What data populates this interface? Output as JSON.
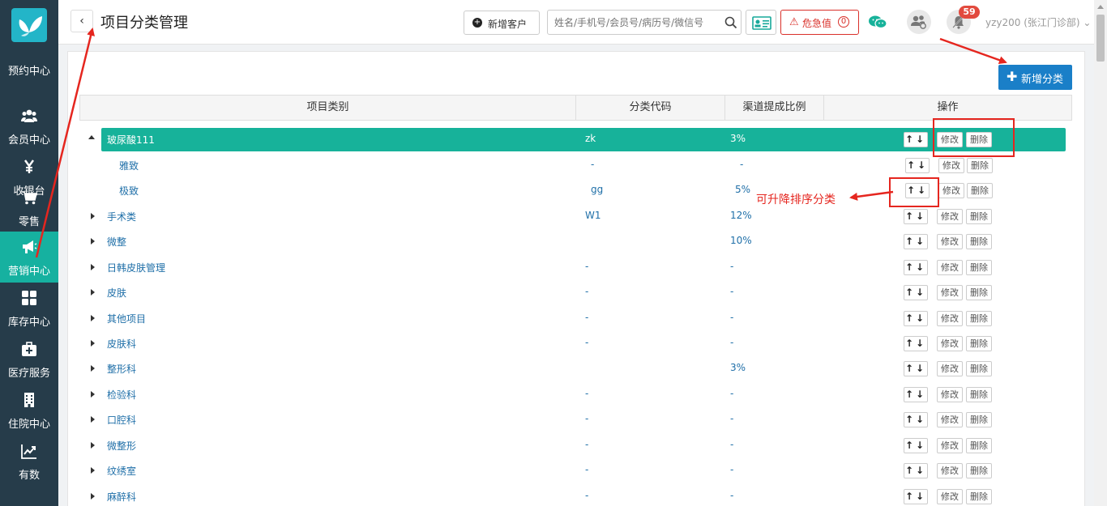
{
  "sidebar": {
    "items": [
      {
        "label": "预约中心",
        "icon": "calendar-icon"
      },
      {
        "label": "会员中心",
        "icon": "users-icon"
      },
      {
        "label": "收银台",
        "icon": "yen-icon"
      },
      {
        "label": "零售",
        "icon": "cart-icon"
      },
      {
        "label": "营销中心",
        "icon": "megaphone-icon",
        "active": true
      },
      {
        "label": "库存中心",
        "icon": "grid-icon"
      },
      {
        "label": "医疗服务",
        "icon": "medkit-icon"
      },
      {
        "label": "住院中心",
        "icon": "building-icon"
      },
      {
        "label": "有数",
        "icon": "trend-icon"
      }
    ]
  },
  "header": {
    "back": "‹",
    "title": "项目分类管理",
    "add_customer": "新增客户",
    "search_placeholder": "姓名/手机号/会员号/病历号/微信号",
    "critical_icon": "⚠",
    "critical_label": "危急值",
    "critical_count": "0",
    "notification_count": "59",
    "user": "yzy200 (张江门诊部) ⌄"
  },
  "toolbar": {
    "add_category": "新增分类",
    "add_category_plus": "✚"
  },
  "table": {
    "headers": [
      "项目类别",
      "分类代码",
      "渠道提成比例",
      "操作"
    ],
    "sort_label": "↑↓",
    "edit_label": "修改",
    "delete_label": "删除",
    "rows": [
      {
        "name": "玻尿酸111",
        "code": "zk",
        "ratio": "3%",
        "level": 0,
        "toggle": "expanded",
        "selected": true
      },
      {
        "name": "雅致",
        "code": "-",
        "ratio": "-",
        "level": 1,
        "toggle": "none"
      },
      {
        "name": "极致",
        "code": "gg",
        "ratio": "5%",
        "level": 1,
        "toggle": "none"
      },
      {
        "name": "手术类",
        "code": "W1",
        "ratio": "12%",
        "level": 0,
        "toggle": "collapsed"
      },
      {
        "name": "微整",
        "code": "",
        "ratio": "10%",
        "level": 0,
        "toggle": "collapsed"
      },
      {
        "name": "日韩皮肤管理",
        "code": "-",
        "ratio": "-",
        "level": 0,
        "toggle": "collapsed"
      },
      {
        "name": "皮肤",
        "code": "-",
        "ratio": "-",
        "level": 0,
        "toggle": "collapsed"
      },
      {
        "name": "其他项目",
        "code": "-",
        "ratio": "-",
        "level": 0,
        "toggle": "collapsed"
      },
      {
        "name": "皮肤科",
        "code": "-",
        "ratio": "-",
        "level": 0,
        "toggle": "collapsed"
      },
      {
        "name": "整形科",
        "code": "",
        "ratio": "3%",
        "level": 0,
        "toggle": "collapsed"
      },
      {
        "name": "检验科",
        "code": "-",
        "ratio": "-",
        "level": 0,
        "toggle": "collapsed"
      },
      {
        "name": "口腔科",
        "code": "-",
        "ratio": "-",
        "level": 0,
        "toggle": "collapsed"
      },
      {
        "name": "微整形",
        "code": "-",
        "ratio": "-",
        "level": 0,
        "toggle": "collapsed"
      },
      {
        "name": "纹绣室",
        "code": "-",
        "ratio": "-",
        "level": 0,
        "toggle": "collapsed"
      },
      {
        "name": "麻醉科",
        "code": "-",
        "ratio": "-",
        "level": 0,
        "toggle": "collapsed"
      }
    ]
  },
  "annotations": {
    "sort_note": "可升降排序分类"
  },
  "colors": {
    "sidebar_bg": "#263c4a",
    "active": "#16b1a0",
    "selected_row": "#17b29a",
    "primary_button": "#1a7fc8",
    "annotation": "#e5261f",
    "link_text": "#1f6fa8"
  }
}
